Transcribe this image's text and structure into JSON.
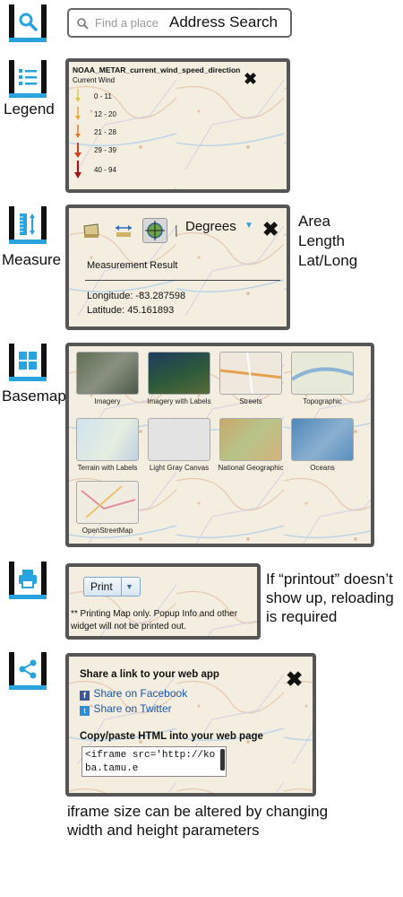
{
  "search": {
    "placeholder": "Find a place",
    "label": "Address Search"
  },
  "legend": {
    "side_label": "Legend",
    "layer_title": "NOAA_METAR_current_wind_speed_direction",
    "subtitle": "Current Wind",
    "items": [
      {
        "label": "0 - 11",
        "color": "#d9c94a"
      },
      {
        "label": "12 - 20",
        "color": "#e9a53a"
      },
      {
        "label": "21 - 28",
        "color": "#e57a2a"
      },
      {
        "label": "29 - 39",
        "color": "#d54020"
      },
      {
        "label": "40 - 94",
        "color": "#a3171a"
      }
    ]
  },
  "measure": {
    "side_label": "Measure",
    "unit": "Degrees",
    "result_title": "Measurement Result",
    "longitude": "Longitude: -83.287598",
    "latitude": "Latitude: 45.161893",
    "modes": [
      "Area",
      "Length",
      "Lat/Long"
    ]
  },
  "basemap": {
    "side_label": "Basemap",
    "items": [
      {
        "label": "Imagery"
      },
      {
        "label": "Imagery with Labels"
      },
      {
        "label": "Streets"
      },
      {
        "label": "Topographic"
      },
      {
        "label": "Terrain with Labels"
      },
      {
        "label": "Light Gray Canvas"
      },
      {
        "label": "National Geographic"
      },
      {
        "label": "Oceans"
      },
      {
        "label": "OpenStreetMap"
      }
    ]
  },
  "print": {
    "button_label": "Print",
    "footnote": "** Printing Map only. Popup Info and other widget will not be printed out.",
    "note": "If “printout” doesn’t show up, reloading is required"
  },
  "share": {
    "link_title": "Share a link to your web app",
    "facebook": "Share on Facebook",
    "twitter": "Share on Twitter",
    "embed_title": "Copy/paste HTML into your web page",
    "embed_code": "<iframe src='http://koba.tamu.e",
    "note": "iframe size can be altered by changing width and height parameters"
  },
  "colors": {
    "accent": "#29a3dd",
    "border": "#555555",
    "link": "#1a57a8"
  }
}
